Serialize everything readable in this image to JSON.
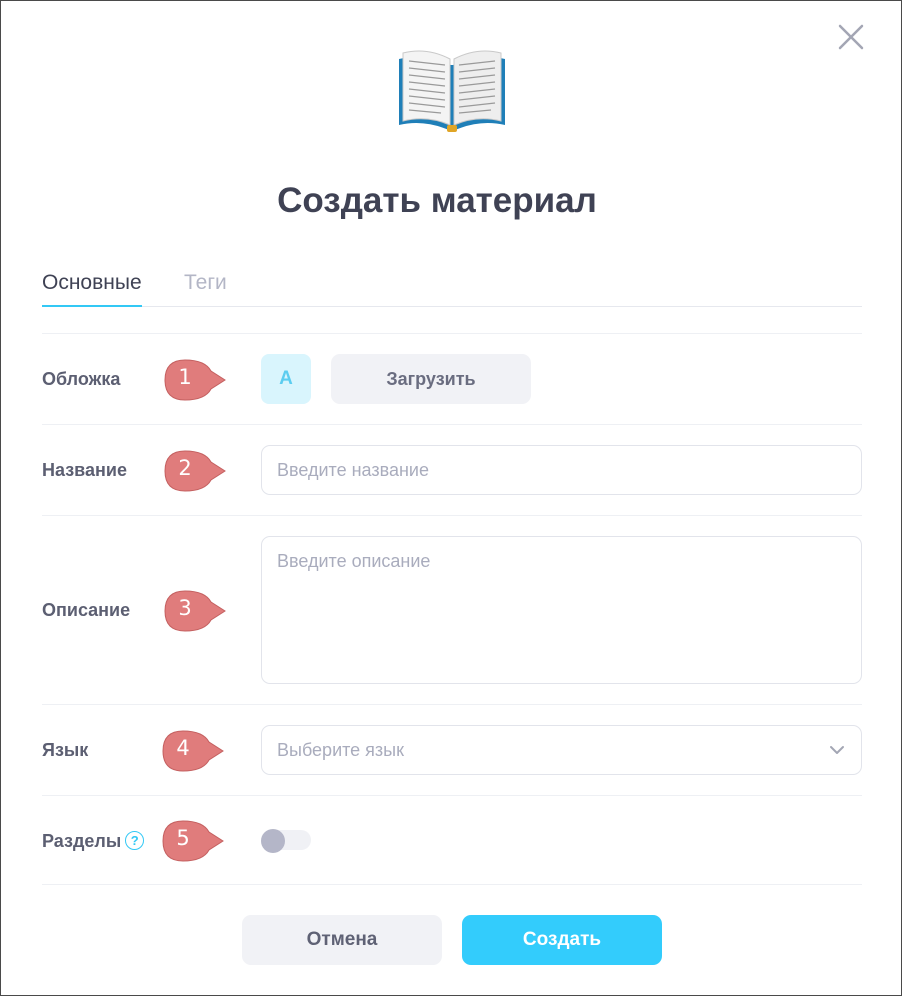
{
  "dialog": {
    "title": "Создать материал",
    "close_icon": "close-icon",
    "illustration_icon": "open-book-icon"
  },
  "tabs": [
    {
      "label": "Основные",
      "active": true
    },
    {
      "label": "Теги",
      "active": false
    }
  ],
  "fields": {
    "cover": {
      "label": "Обложка",
      "avatar_letter": "A",
      "upload_label": "Загрузить",
      "marker": "1"
    },
    "name": {
      "label": "Название",
      "placeholder": "Введите название",
      "value": "",
      "marker": "2"
    },
    "description": {
      "label": "Описание",
      "placeholder": "Введите описание",
      "value": "",
      "marker": "3"
    },
    "language": {
      "label": "Язык",
      "placeholder": "Выберите язык",
      "marker": "4",
      "icon": "chevron-down-icon"
    },
    "sections": {
      "label": "Разделы",
      "help": "?",
      "marker": "5",
      "enabled": false
    }
  },
  "actions": {
    "cancel_label": "Отмена",
    "create_label": "Создать"
  },
  "colors": {
    "accent": "#33ccfc",
    "marker": "#e07c7c",
    "title": "#3f4254"
  }
}
